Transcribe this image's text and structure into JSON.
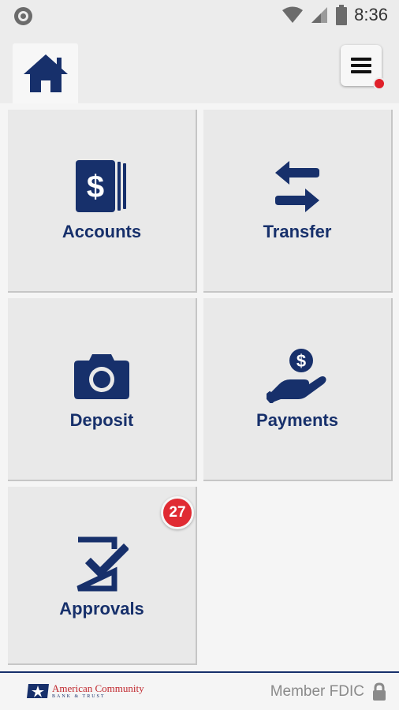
{
  "status_bar": {
    "time": "8:36"
  },
  "tiles": [
    {
      "label": "Accounts",
      "icon": "accounts-icon"
    },
    {
      "label": "Transfer",
      "icon": "transfer-icon"
    },
    {
      "label": "Deposit",
      "icon": "camera-icon"
    },
    {
      "label": "Payments",
      "icon": "payment-hand-icon"
    },
    {
      "label": "Approvals",
      "icon": "approval-check-icon",
      "badge": "27"
    }
  ],
  "footer": {
    "bank_name": "American Community",
    "bank_sub": "BANK & TRUST",
    "fdic": "Member FDIC"
  },
  "colors": {
    "brand_navy": "#17306b",
    "badge_red": "#e02b33",
    "tile_bg": "#e9e9e9"
  }
}
